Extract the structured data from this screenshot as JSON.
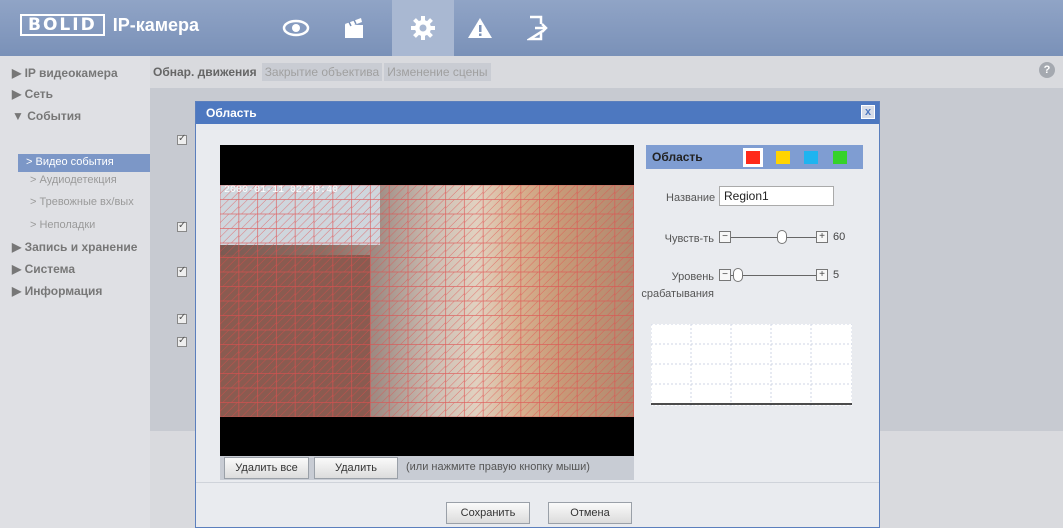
{
  "header": {
    "logo": "BOLID",
    "title": "IP-камера",
    "nav_icons": [
      "eye-icon",
      "clapperboard-icon",
      "gear-icon",
      "warning-icon",
      "exit-icon"
    ]
  },
  "sidebar": {
    "items": [
      {
        "label": "▶ IP видеокамера"
      },
      {
        "label": "▶ Сеть"
      },
      {
        "label": "▼ События"
      },
      {
        "label": "> Видео события"
      },
      {
        "label": "> Аудиодетекция"
      },
      {
        "label": "> Тревожные вх/вых"
      },
      {
        "label": "> Неполадки"
      },
      {
        "label": "▶ Запись и хранение"
      },
      {
        "label": "▶ Система"
      },
      {
        "label": "▶ Информация"
      }
    ]
  },
  "tabs": [
    "Обнар. движения",
    "Закрытие объектива",
    "Изменение сцены"
  ],
  "modal": {
    "title": "Область",
    "close": "x",
    "osd": "2000-01-11 02:30:40",
    "buttons": {
      "delete_all": "Удалить все",
      "delete": "Удалить",
      "hint": "(или нажмите правую кнопку мыши)",
      "save": "Сохранить",
      "cancel": "Отмена"
    },
    "panel": {
      "header": "Область",
      "colors": [
        "#ff2a1a",
        "#ffd400",
        "#1eb4f0",
        "#35d22a"
      ],
      "name_label": "Название",
      "name_value": "Region1",
      "sens_label": "Чувств-ть",
      "sens_value": "60",
      "level_label_1": "Уровень",
      "level_label_2": "срабатывания",
      "level_value": "5"
    }
  }
}
